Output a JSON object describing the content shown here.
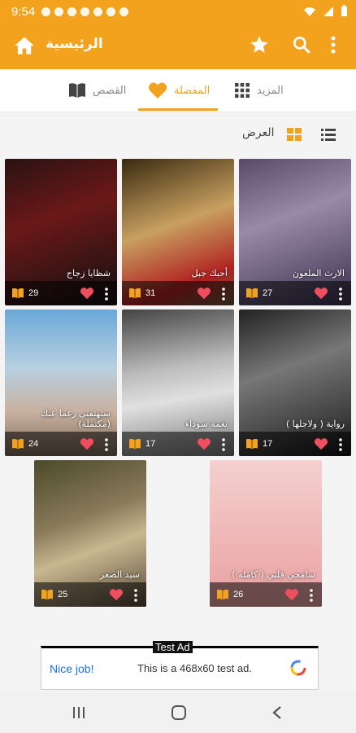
{
  "status": {
    "time": "9:54"
  },
  "appbar": {
    "title": "الرئيسية"
  },
  "tabs": [
    {
      "label": "المزيد"
    },
    {
      "label": "المفضلة"
    },
    {
      "label": "القصص"
    }
  ],
  "view": {
    "label": "العرض"
  },
  "cards": [
    {
      "title": "شظايا زجاج",
      "count": "29"
    },
    {
      "title": "أحبك جبل",
      "count": "31"
    },
    {
      "title": "الارث الملعون",
      "count": "27"
    },
    {
      "title": "ستهتفني رغما عنك (مكتملة)",
      "count": "24"
    },
    {
      "title": "نغمة سوداء",
      "count": "17"
    },
    {
      "title": "( رواية ( ولاجلها",
      "count": "17"
    },
    {
      "title": "سيد الصغر",
      "count": "25"
    },
    {
      "title": "سامحي قلبي ( كامله )",
      "count": "26"
    }
  ],
  "ad": {
    "tag": "Test Ad",
    "nice": "Nice job!",
    "message": "This is a 468x60 test ad."
  },
  "colors": {
    "accent": "#f2a21c",
    "heart": "#f04e5e"
  }
}
